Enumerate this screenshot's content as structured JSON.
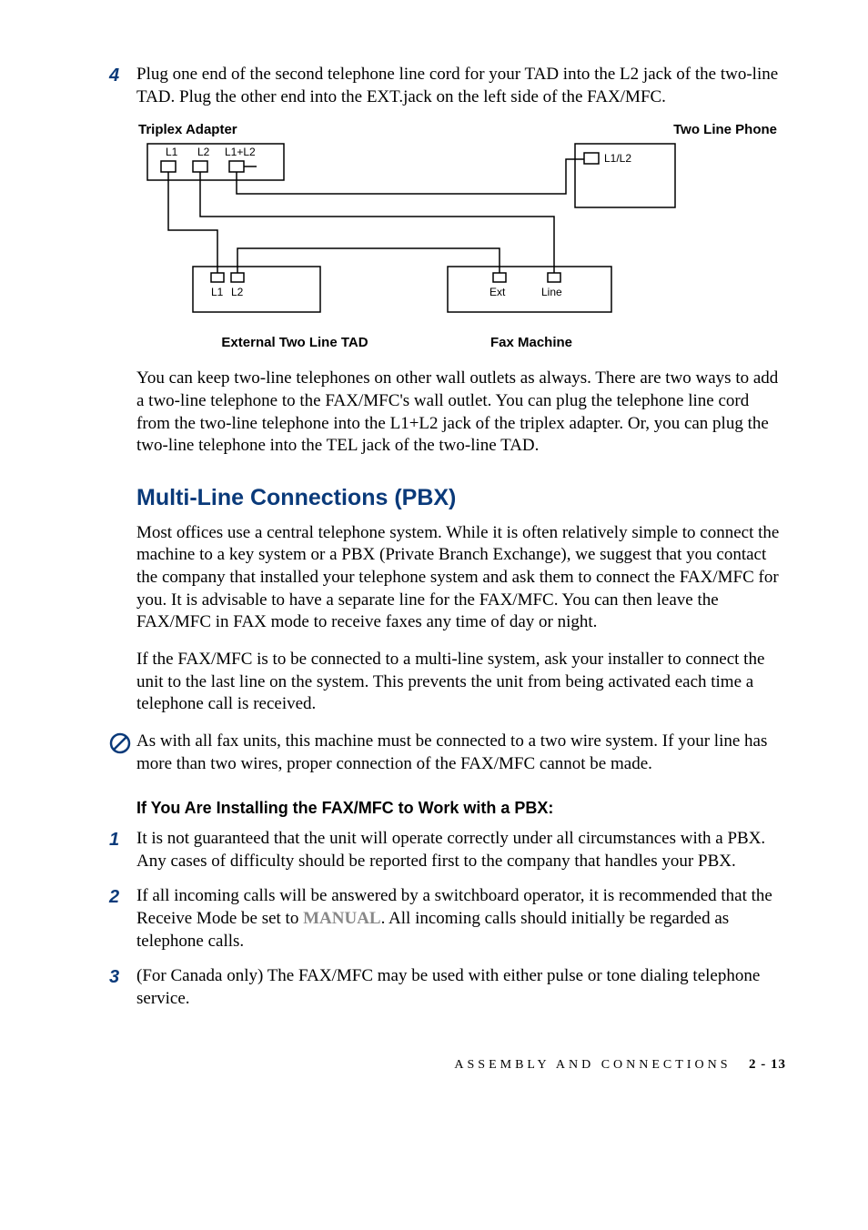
{
  "step4": {
    "num": "4",
    "text": "Plug one end of the second telephone line cord for your TAD into the L2 jack of the two-line TAD. Plug the other end into the EXT.jack on the left side of the FAX/MFC."
  },
  "diagram": {
    "triplex": "Triplex Adapter",
    "twoline_phone": "Two Line Phone",
    "jack_l1": "L1",
    "jack_l2": "L2",
    "jack_l1l2_combined": "L1+L2",
    "phone_l1l2": "L1/L2",
    "tad_l1": "L1",
    "tad_l2": "L2",
    "fax_ext": "Ext",
    "fax_line": "Line",
    "external_tad": "External Two Line TAD",
    "fax_machine": "Fax Machine"
  },
  "para_after_diagram": "You can keep two-line telephones on other wall outlets as always. There are two ways to add a two-line telephone to the FAX/MFC's wall outlet. You can plug the telephone line cord from the two-line telephone into the L1+L2 jack of the triplex adapter.  Or, you can plug the two-line telephone into the TEL jack of the two-line TAD.",
  "section_heading": "Multi-Line Connections (PBX)",
  "section_para1": "Most offices use a central telephone system. While it is often relatively simple to connect the machine to a key system or a PBX (Private Branch Exchange), we suggest that you contact the company that installed your telephone system and ask them to connect the FAX/MFC for you. It is advisable to have a separate line for the FAX/MFC. You can then leave the FAX/MFC in FAX mode to receive faxes any time of day or night.",
  "section_para2": "If the FAX/MFC is to be connected to a multi-line system, ask your installer to connect the unit to the last line on the system. This prevents the unit from being activated each time a telephone call is received.",
  "note_text": "As with all fax units, this machine must be connected to a two wire system. If your line has more than two wires, proper connection of the FAX/MFC cannot be made.",
  "subhead": "If You Are Installing the FAX/MFC to Work with a PBX:",
  "step1": {
    "num": "1",
    "text": "It is not guaranteed that the unit will operate correctly under all circumstances with a PBX. Any cases of difficulty should be reported first to the company that handles your PBX."
  },
  "step2": {
    "num": "2",
    "pre": "If all incoming calls will be answered by a switchboard operator, it is recommended that the Receive Mode be set to ",
    "key": "MANUAL",
    "post": ". All incoming calls should initially be regarded as telephone calls."
  },
  "step3": {
    "num": "3",
    "text": "(For Canada only) The FAX/MFC may be used with either pulse or tone dialing telephone service."
  },
  "footer": {
    "title": "ASSEMBLY AND CONNECTIONS",
    "page": "2 - 13"
  }
}
